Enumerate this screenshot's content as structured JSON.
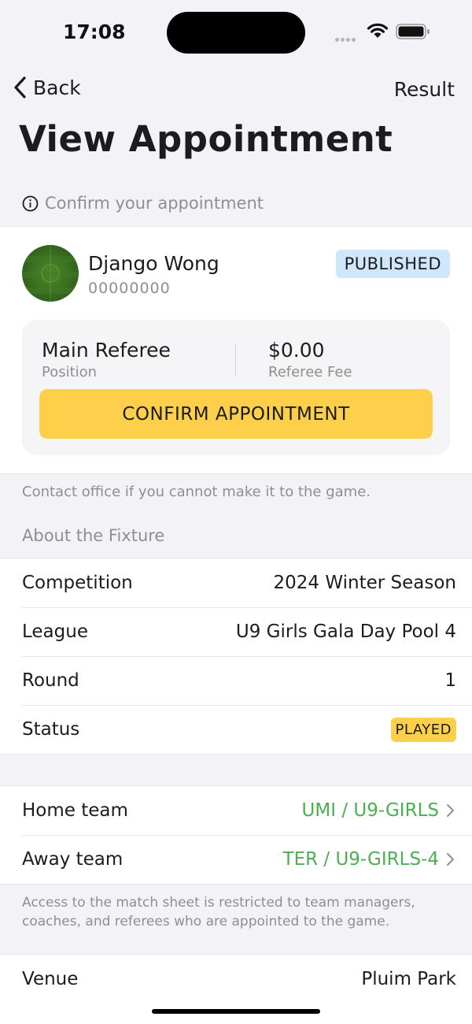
{
  "status_bar": {
    "time": "17:08"
  },
  "nav": {
    "back_label": "Back",
    "result_label": "Result"
  },
  "page_title": "View Appointment",
  "info_banner": {
    "icon": "info-circle-icon",
    "text": "Confirm your appointment"
  },
  "referee": {
    "name": "Django Wong",
    "id": "00000000",
    "status_badge": "PUBLISHED",
    "position_value": "Main Referee",
    "position_label": "Position",
    "fee_value": "$0.00",
    "fee_label": "Referee Fee",
    "confirm_button": "CONFIRM APPOINTMENT"
  },
  "contact_note": "Contact office if you cannot make it to the game.",
  "fixture": {
    "section_title": "About the Fixture",
    "competition_label": "Competition",
    "competition_value": "2024 Winter Season",
    "league_label": "League",
    "league_value": "U9 Girls Gala Day Pool 4",
    "round_label": "Round",
    "round_value": "1",
    "status_label": "Status",
    "status_value": "PLAYED"
  },
  "teams": {
    "home_label": "Home team",
    "home_value": "UMI / U9-GIRLS",
    "away_label": "Away team",
    "away_value": "TER / U9-GIRLS-4"
  },
  "access_note": "Access to the match sheet is restricted to team managers, coaches, and referees who are appointed to the game.",
  "venue": {
    "venue_label": "Venue",
    "venue_value": "Pluim Park"
  },
  "colors": {
    "accent_yellow": "#fdcf4a",
    "badge_blue": "#cfe6fb",
    "link_green": "#4caf50",
    "background": "#f2f2f7"
  }
}
